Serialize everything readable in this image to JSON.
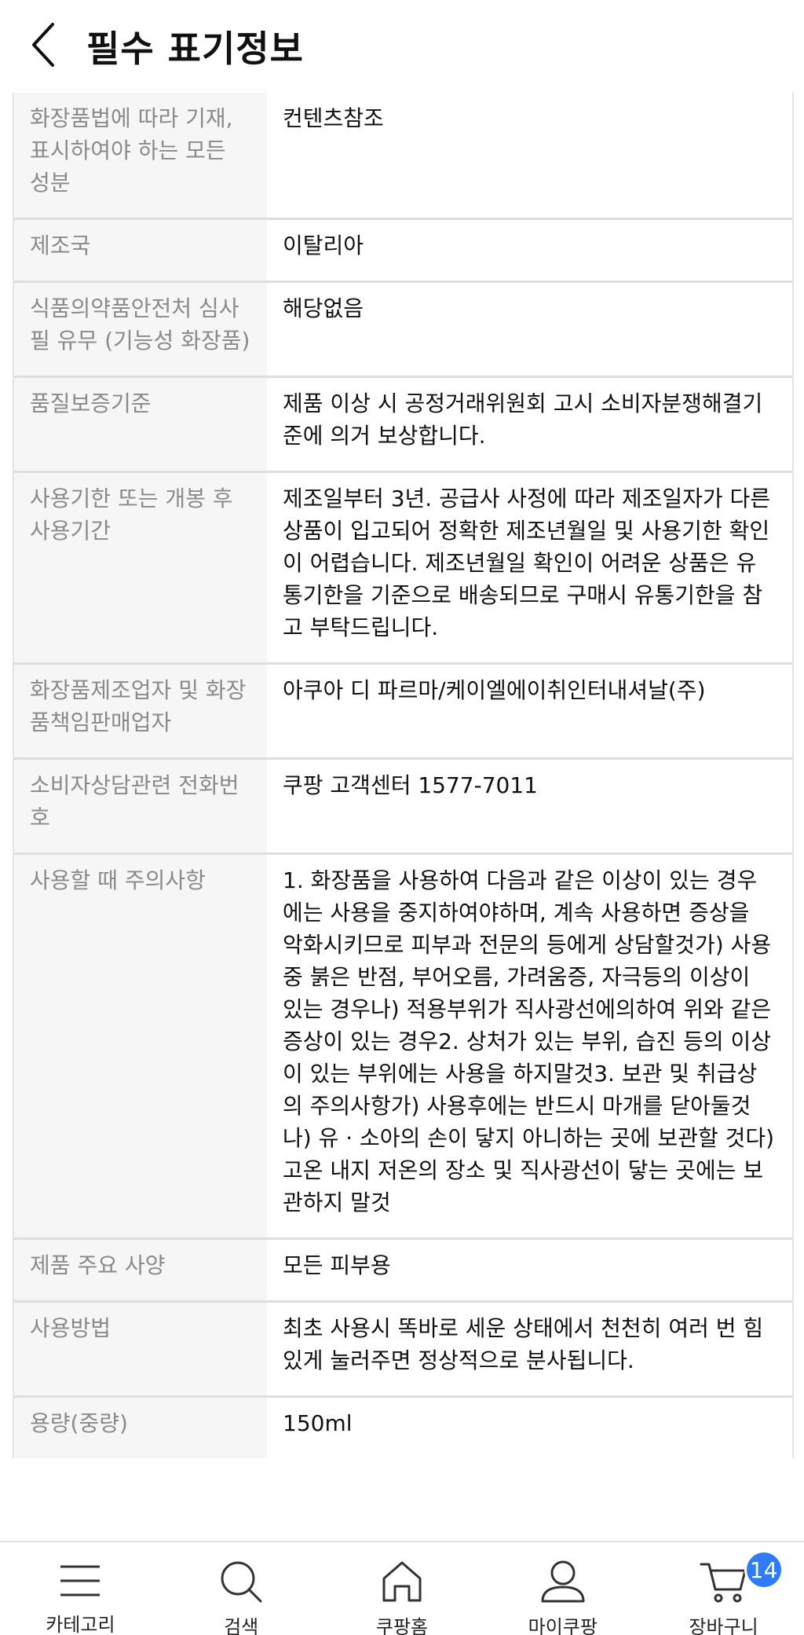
{
  "header": {
    "title": "필수 표기정보"
  },
  "rows": [
    {
      "label": "화장품법에 따라 기재, 표시하여야 하는 모든 성분",
      "value": "컨텐츠참조"
    },
    {
      "label": "제조국",
      "value": "이탈리아"
    },
    {
      "label": "식품의약품안전처 심사필 유무 (기능성 화장품)",
      "value": "해당없음"
    },
    {
      "label": "품질보증기준",
      "value": "제품 이상 시 공정거래위원회 고시 소비자분쟁해결기준에 의거 보상합니다."
    },
    {
      "label": "사용기한 또는 개봉 후 사용기간",
      "value": "제조일부터 3년. 공급사 사정에 따라 제조일자가 다른 상품이 입고되어 정확한 제조년월일 및 사용기한 확인이 어렵습니다. 제조년월일 확인이 어려운 상품은 유통기한을 기준으로 배송되므로 구매시 유통기한을 참고 부탁드립니다."
    },
    {
      "label": "화장품제조업자 및 화장품책임판매업자",
      "value": "아쿠아 디 파르마/케이엘에이취인터내셔날(주)"
    },
    {
      "label": "소비자상담관련 전화번호",
      "value": "쿠팡 고객센터 1577-7011"
    },
    {
      "label": "사용할 때 주의사항",
      "value": "1. 화장품을 사용하여 다음과 같은 이상이 있는 경우에는 사용을 중지하여야하며, 계속 사용하면 증상을 악화시키므로 피부과 전문의 등에게 상담할것가) 사용중 붉은 반점, 부어오름, 가려움증, 자극등의 이상이 있는 경우나) 적용부위가 직사광선에의하여 위와 같은 증상이 있는 경우2. 상처가 있는 부위, 습진 등의 이상이 있는 부위에는 사용을 하지말것3. 보관 및 취급상의 주의사항가) 사용후에는 반드시 마개를 닫아둘것나) 유 · 소아의 손이 닿지 아니하는 곳에 보관할 것다) 고온 내지 저온의 장소 및 직사광선이 닿는 곳에는 보관하지 말것"
    },
    {
      "label": "제품 주요 사양",
      "value": "모든 피부용"
    },
    {
      "label": "사용방법",
      "value": "최초 사용시 똑바로 세운 상태에서 천천히 여러 번 힘있게 눌러주면 정상적으로 분사됩니다."
    },
    {
      "label": "용량(중량)",
      "value": "150ml"
    }
  ],
  "bottom_nav": {
    "items": [
      {
        "label": "카테고리",
        "icon": "menu-icon"
      },
      {
        "label": "검색",
        "icon": "search-icon"
      },
      {
        "label": "쿠팡홈",
        "icon": "home-icon"
      },
      {
        "label": "마이쿠팡",
        "icon": "user-icon"
      },
      {
        "label": "장바구니",
        "icon": "cart-icon",
        "badge": "14"
      }
    ]
  },
  "colors": {
    "label_bg": "#f6f6f6",
    "label_text": "#8a8a8a",
    "badge": "#2f7cf6"
  }
}
